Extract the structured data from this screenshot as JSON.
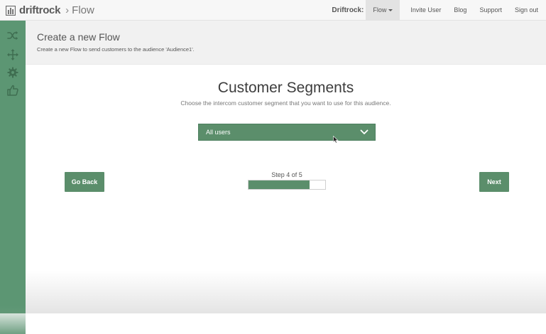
{
  "navbar": {
    "brand": "driftrock",
    "separator": "›",
    "app": "Flow",
    "org": "Driftrock:",
    "dropdown_label": "Flow",
    "links": [
      "Invite User",
      "Blog",
      "Support",
      "Sign out"
    ]
  },
  "sidebar": {
    "icons": [
      "shuffle-icon",
      "move-icon",
      "gear-icon",
      "thumbs-up-icon"
    ]
  },
  "header": {
    "title": "Create a new Flow",
    "subtitle": "Create a new Flow to send customers to the audience 'Audience1'."
  },
  "main": {
    "heading": "Customer Segments",
    "description": "Choose the intercom customer segment that you want to use for this audience.",
    "segment_select": {
      "value": "All users"
    },
    "back_label": "Go Back",
    "next_label": "Next",
    "step_label": "Step 4 of 5",
    "progress": 0.8
  },
  "colors": {
    "accent": "#5b8e6b",
    "sidebar": "#5c9673"
  }
}
